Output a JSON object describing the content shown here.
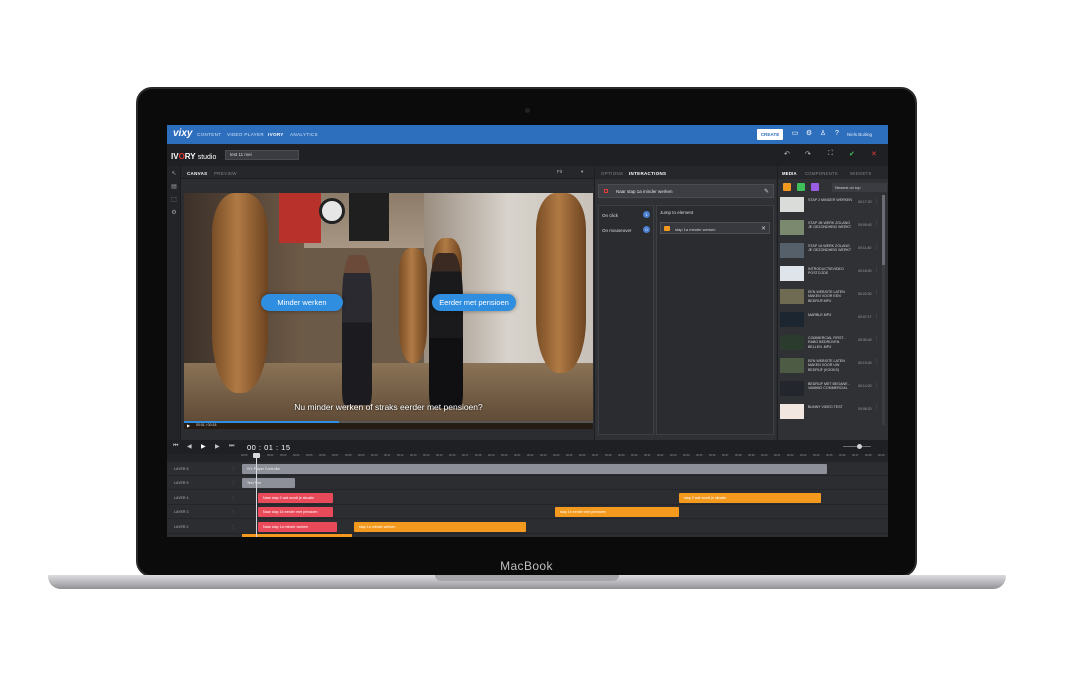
{
  "device": {
    "label": "MacBook"
  },
  "nav": {
    "brand": "vixy",
    "links": [
      "CONTENT",
      "VIDEO PLAYER",
      "IVORY",
      "ANALYTICS"
    ],
    "create": "CREATE",
    "user": "Niels Buiting"
  },
  "studio": {
    "iv": "IV",
    "o": "O",
    "ry": "RY",
    "suffix": "studio",
    "project": "test 11 mei"
  },
  "canvas": {
    "tabs": [
      "CANVAS",
      "PREVIEW"
    ],
    "fit": "Fit"
  },
  "video": {
    "hotspot_left": "Minder werken",
    "hotspot_right": "Eerder met pensioen",
    "subtitle": "Nu minder werken of straks eerder met pensioen?",
    "time": "00:01 / 00:18",
    "progress": 0.38
  },
  "panel": {
    "tabs": [
      "OPTIONS",
      "INTERACTIONS"
    ],
    "header": "Naar stap 1a minder werken",
    "events": [
      {
        "label": "On click",
        "count": "1"
      },
      {
        "label": "On mouseover",
        "count": "0"
      }
    ],
    "action_type": "Jump to element",
    "action_item": "stap 1a minder werken"
  },
  "media": {
    "tabs": [
      "MEDIA",
      "COMPONENTS",
      "WIDGETS"
    ],
    "sort": "Newest on top",
    "items": [
      {
        "title": "STAP 2 MINDER WERKEN",
        "dur": "00:17:20"
      },
      {
        "title": "STAP 1B WERK ZOLANG JE GEZONDHEID WERKT",
        "dur": "00:09:40"
      },
      {
        "title": "STAP 1A WERK ZOLANG JE GEZONDHEID WERKT",
        "dur": "00:11:40"
      },
      {
        "title": "INTRODUCTIEVIDEO POSTCODE",
        "dur": "00:18:00"
      },
      {
        "title": "EEN WEBSITE LATEN MAKEN VOOR EEN BEDRIJF.MP4",
        "dur": "00:22:00"
      },
      {
        "title": "MARBLE.MP4",
        "dur": "00:07:17"
      },
      {
        "title": "COMMERCIAL FIRST - RABO BEDRIJVEN BELLEN .MP4",
        "dur": "00:30:40"
      },
      {
        "title": "EEN WEBSITE LATEN MAKEN VOOR UW BEDRIJF (KOOKS)",
        "dur": "00:19:40"
      },
      {
        "title": "BEDRIJF MET BEGANE - VAMMIO COMMERCIAL",
        "dur": "00:14:20"
      },
      {
        "title": "BUNNY VIDEO TEST",
        "dur": "00:08:20"
      }
    ],
    "colors": [
      "#d9dcd8",
      "#7b8a6e",
      "#56606b",
      "#dfe4ea",
      "#6f6a52",
      "#1c2631",
      "#2b3b2d",
      "#4d5a44",
      "#23272d",
      "#f1e7e0"
    ]
  },
  "timeline": {
    "timecode": "00 : 01 : 15",
    "ticks": [
      "00:00",
      "00:01",
      "00:02",
      "00:03",
      "00:04",
      "00:05",
      "00:06",
      "00:07",
      "00:08",
      "00:09",
      "00:10",
      "00:11",
      "00:12",
      "00:13",
      "00:14",
      "00:15",
      "00:16",
      "00:17",
      "00:18",
      "00:19",
      "00:20",
      "00:21",
      "00:22",
      "00:23",
      "00:24",
      "00:25",
      "00:26",
      "00:27",
      "00:28",
      "00:29",
      "00:30",
      "00:31",
      "00:32",
      "00:33",
      "00:34",
      "00:35",
      "00:36",
      "00:37",
      "00:38",
      "00:39",
      "00:40",
      "00:41",
      "00:42",
      "00:43",
      "00:44",
      "00:45",
      "00:46",
      "00:47",
      "00:48",
      "00:49"
    ],
    "tracks": [
      {
        "label": "LAYER 6",
        "clips": [
          {
            "text": "IVY Player Controller",
            "color": "grey"
          }
        ]
      },
      {
        "label": "LAYER 5",
        "clips": [
          {
            "text": "Test Text",
            "color": "grey"
          }
        ]
      },
      {
        "label": "LAYER 4",
        "clips": [
          {
            "text": "Naar stap 2 wat wordt je situatie",
            "color": "red"
          },
          {
            "text": "stap 2 wat wordt je situatie",
            "color": "orange"
          }
        ]
      },
      {
        "label": "LAYER 3",
        "clips": [
          {
            "text": "Naar stap 1b eerder met pensioen",
            "color": "red"
          },
          {
            "text": "stap 1b eerder met pensioen",
            "color": "orange"
          }
        ]
      },
      {
        "label": "LAYER 2",
        "clips": [
          {
            "text": "Naar stap 1a minder werken",
            "color": "red"
          },
          {
            "text": "stap 1a minder werken",
            "color": "orange"
          }
        ]
      }
    ]
  }
}
